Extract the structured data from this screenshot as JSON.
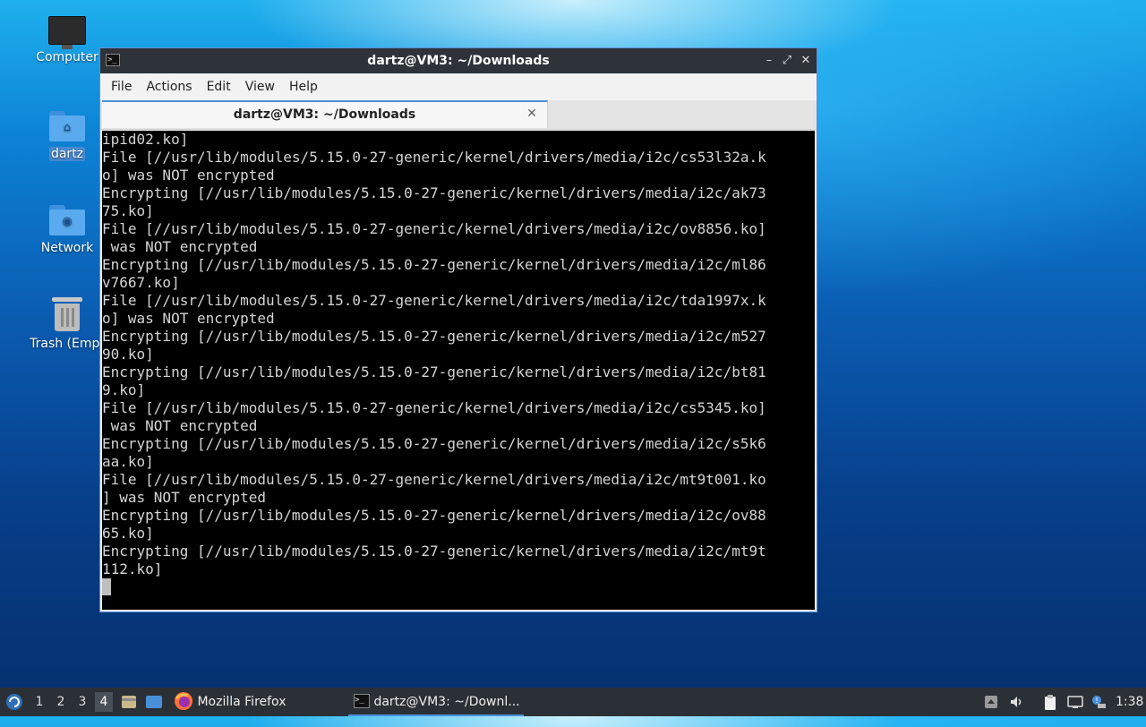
{
  "desktop": {
    "icons": [
      {
        "label": "Computer"
      },
      {
        "label": "dartz"
      },
      {
        "label": "Network"
      },
      {
        "label": "Trash (Empt"
      }
    ]
  },
  "window": {
    "title": "dartz@VM3: ~/Downloads",
    "menu": [
      "File",
      "Actions",
      "Edit",
      "View",
      "Help"
    ],
    "tab_title": "dartz@VM3: ~/Downloads",
    "terminal_lines": [
      "ipid02.ko]",
      "File [//usr/lib/modules/5.15.0-27-generic/kernel/drivers/media/i2c/cs53l32a.k",
      "o] was NOT encrypted",
      "Encrypting [//usr/lib/modules/5.15.0-27-generic/kernel/drivers/media/i2c/ak73",
      "75.ko]",
      "File [//usr/lib/modules/5.15.0-27-generic/kernel/drivers/media/i2c/ov8856.ko]",
      " was NOT encrypted",
      "Encrypting [//usr/lib/modules/5.15.0-27-generic/kernel/drivers/media/i2c/ml86",
      "v7667.ko]",
      "File [//usr/lib/modules/5.15.0-27-generic/kernel/drivers/media/i2c/tda1997x.k",
      "o] was NOT encrypted",
      "Encrypting [//usr/lib/modules/5.15.0-27-generic/kernel/drivers/media/i2c/m527",
      "90.ko]",
      "Encrypting [//usr/lib/modules/5.15.0-27-generic/kernel/drivers/media/i2c/bt81",
      "9.ko]",
      "File [//usr/lib/modules/5.15.0-27-generic/kernel/drivers/media/i2c/cs5345.ko]",
      " was NOT encrypted",
      "Encrypting [//usr/lib/modules/5.15.0-27-generic/kernel/drivers/media/i2c/s5k6",
      "aa.ko]",
      "File [//usr/lib/modules/5.15.0-27-generic/kernel/drivers/media/i2c/mt9t001.ko",
      "] was NOT encrypted",
      "Encrypting [//usr/lib/modules/5.15.0-27-generic/kernel/drivers/media/i2c/ov88",
      "65.ko]",
      "Encrypting [//usr/lib/modules/5.15.0-27-generic/kernel/drivers/media/i2c/mt9t",
      "112.ko]"
    ]
  },
  "panel": {
    "workspaces": [
      "1",
      "2",
      "3",
      "4"
    ],
    "active_workspace": "4",
    "tasks": [
      {
        "label": "Mozilla Firefox",
        "icon": "firefox-icon"
      },
      {
        "label": "dartz@VM3: ~/Downl...",
        "icon": "terminal-icon"
      }
    ],
    "clock": "1:38"
  },
  "colors": {
    "accent": "#4a90d9",
    "terminal_bg": "#000000",
    "terminal_fg": "#d4d4d4",
    "panel_bg": "#2b3036"
  }
}
